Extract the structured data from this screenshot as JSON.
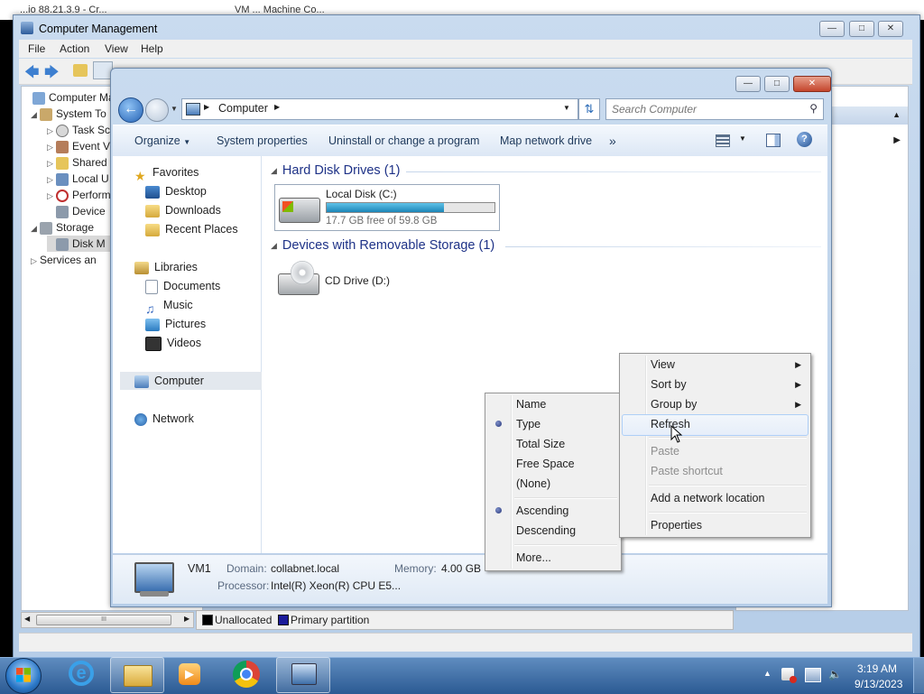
{
  "background_window": {
    "tab_text": "...io 88.21.3.9 - Cr...",
    "tab2_text": "VM ... Machine Co..."
  },
  "compmgmt": {
    "title": "Computer Management",
    "menu": [
      "File",
      "Action",
      "View",
      "Help"
    ],
    "tree": [
      {
        "label": "Computer Mana",
        "icon": "computer-icon"
      },
      {
        "label": "System To",
        "icon": "tools-icon"
      },
      {
        "label": "Task Sc",
        "icon": "clock-icon"
      },
      {
        "label": "Event V",
        "icon": "event-viewer-icon"
      },
      {
        "label": "Shared",
        "icon": "shared-folder-icon"
      },
      {
        "label": "Local U",
        "icon": "users-icon"
      },
      {
        "label": "Perform",
        "icon": "performance-icon"
      },
      {
        "label": "Device",
        "icon": "device-manager-icon"
      },
      {
        "label": "Storage",
        "icon": "storage-icon"
      },
      {
        "label": "Disk M",
        "icon": "disk-management-icon"
      },
      {
        "label": "Services an",
        "icon": "services-icon"
      }
    ],
    "legend": {
      "unallocated": "Unallocated",
      "primary": "Primary partition"
    },
    "hscroll_grip": "III"
  },
  "explorer": {
    "address": {
      "icon": "computer-icon",
      "crumb": "Computer"
    },
    "search_placeholder": "Search Computer",
    "toolbar": {
      "organize": "Organize",
      "system_properties": "System properties",
      "uninstall": "Uninstall or change a program",
      "map_drive": "Map network drive",
      "more": "»"
    },
    "nav": {
      "favorites": "Favorites",
      "desktop": "Desktop",
      "downloads": "Downloads",
      "recent": "Recent Places",
      "libraries": "Libraries",
      "documents": "Documents",
      "music": "Music",
      "pictures": "Pictures",
      "videos": "Videos",
      "computer": "Computer",
      "network": "Network"
    },
    "groups": {
      "hdd": "Hard Disk Drives (1)",
      "removable": "Devices with Removable Storage (1)"
    },
    "local_disk": {
      "name": "Local Disk (C:)",
      "free_text": "17.7 GB free of 59.8 GB",
      "used_fraction": 0.7
    },
    "cd_drive": {
      "name": "CD Drive (D:)"
    },
    "details": {
      "name": "VM1",
      "domain_label": "Domain:",
      "domain_value": "collabnet.local",
      "memory_label": "Memory:",
      "memory_value": "4.00 GB",
      "processor_label": "Processor:",
      "processor_value": "Intel(R) Xeon(R) CPU E5..."
    }
  },
  "context_menu": {
    "view": "View",
    "sort_by": "Sort by",
    "group_by": "Group by",
    "refresh": "Refresh",
    "paste": "Paste",
    "paste_shortcut": "Paste shortcut",
    "add_network_location": "Add a network location",
    "properties": "Properties"
  },
  "group_submenu": {
    "name": "Name",
    "type": "Type",
    "total_size": "Total Size",
    "free_space": "Free Space",
    "none": "(None)",
    "ascending": "Ascending",
    "descending": "Descending",
    "more": "More..."
  },
  "taskbar": {
    "time": "3:19 AM",
    "date": "9/13/2023"
  }
}
